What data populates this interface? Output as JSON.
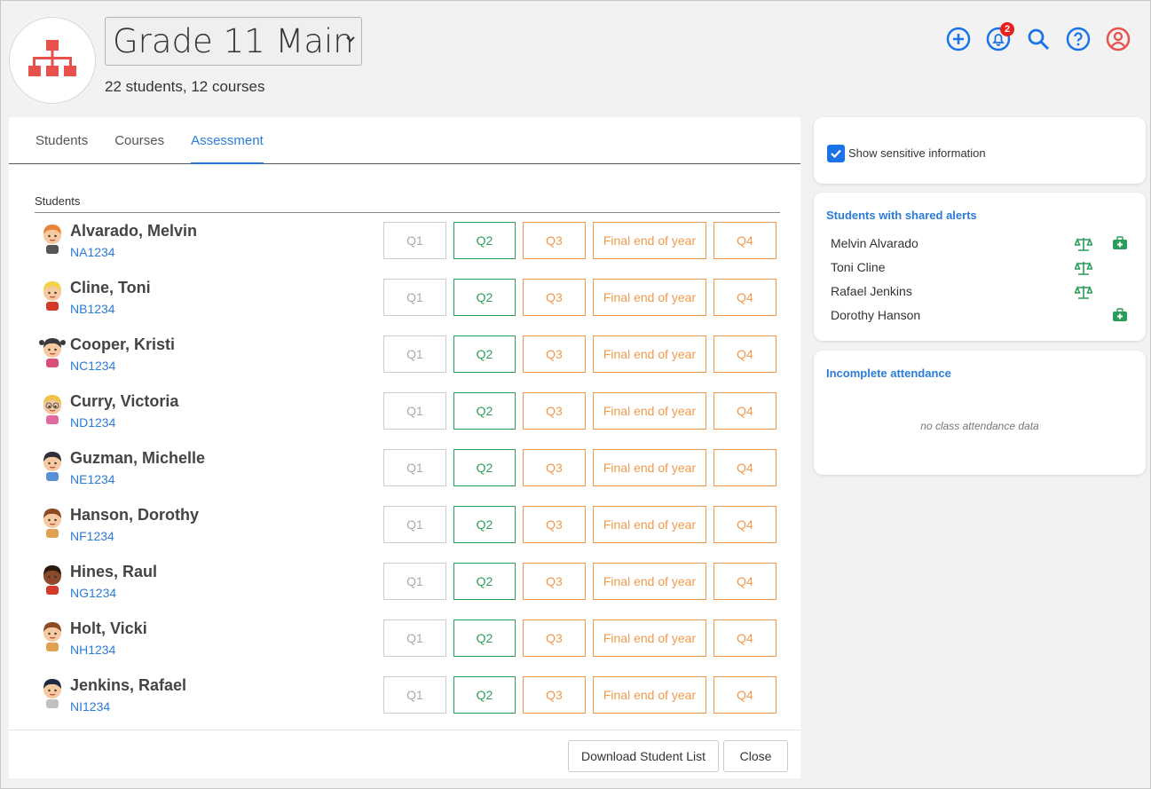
{
  "header": {
    "class_name": "Grade 11 Main",
    "subtitle": "22 students, 12 courses",
    "notification_count": "2"
  },
  "tabs": [
    {
      "label": "Students"
    },
    {
      "label": "Courses"
    },
    {
      "label": "Assessment",
      "active": true
    }
  ],
  "table": {
    "header": "Students",
    "buttons": {
      "q1": "Q1",
      "q2": "Q2",
      "q3": "Q3",
      "final": "Final end of year",
      "q4": "Q4"
    },
    "students": [
      {
        "name": "Alvarado, Melvin",
        "id": "NA1234",
        "avatar": "boy-orange-hair"
      },
      {
        "name": "Cline, Toni",
        "id": "NB1234",
        "avatar": "girl-blonde-red"
      },
      {
        "name": "Cooper, Kristi",
        "id": "NC1234",
        "avatar": "girl-pigtails"
      },
      {
        "name": "Curry, Victoria",
        "id": "ND1234",
        "avatar": "girl-blonde-glasses"
      },
      {
        "name": "Guzman, Michelle",
        "id": "NE1234",
        "avatar": "girl-dark-hair"
      },
      {
        "name": "Hanson, Dorothy",
        "id": "NF1234",
        "avatar": "girl-brown-hair"
      },
      {
        "name": "Hines, Raul",
        "id": "NG1234",
        "avatar": "boy-dark-skin"
      },
      {
        "name": "Holt, Vicki",
        "id": "NH1234",
        "avatar": "girl-brown-hair"
      },
      {
        "name": "Jenkins, Rafael",
        "id": "NI1234",
        "avatar": "boy-black-hair"
      }
    ]
  },
  "footer": {
    "download_label": "Download Student List",
    "close_label": "Close"
  },
  "sensitive": {
    "label": "Show sensitive information",
    "checked": true
  },
  "alerts": {
    "title": "Students with shared alerts",
    "items": [
      {
        "name": "Melvin Alvarado",
        "icons": [
          "scales-icon",
          "medical-kit-icon"
        ]
      },
      {
        "name": "Toni Cline",
        "icons": [
          "scales-icon"
        ]
      },
      {
        "name": "Rafael Jenkins",
        "icons": [
          "scales-icon"
        ]
      },
      {
        "name": "Dorothy Hanson",
        "icons": [
          "medical-kit-icon"
        ]
      }
    ]
  },
  "attendance": {
    "title": "Incomplete attendance",
    "empty_message": "no class attendance data"
  },
  "colors": {
    "accent": "#2b7bd9",
    "logo_red": "#e8514c",
    "q2_green": "#2a9d5b",
    "orange": "#ef9a4c",
    "alert_green": "#2a9d5b"
  }
}
